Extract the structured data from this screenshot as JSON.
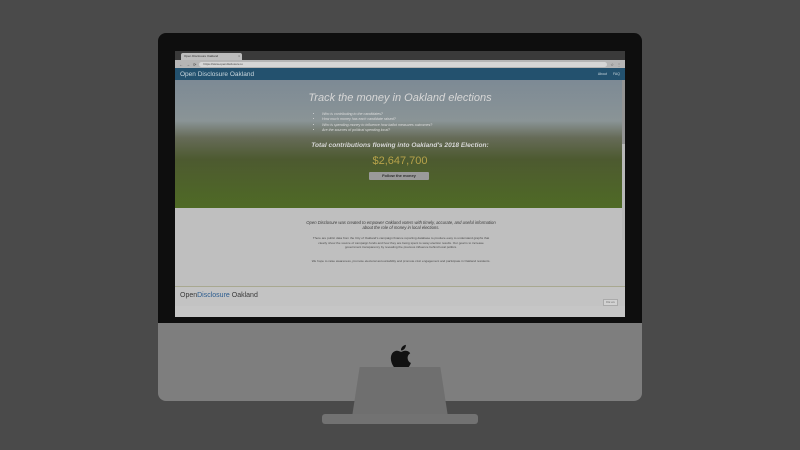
{
  "browser": {
    "tab_title": "Open Disclosure Oakland",
    "tab_close": "×",
    "back": "←",
    "forward": "→",
    "reload": "⟳",
    "url": "https://www.opendisclosure.io",
    "star": "☆",
    "menu": "⋮"
  },
  "site": {
    "brand": "Open Disclosure Oakland",
    "nav": {
      "about": "About",
      "faq": "FAQ"
    }
  },
  "hero": {
    "title": "Track the money in Oakland elections",
    "questions": [
      "Who is contributing to the candidates?",
      "How much money has each candidate raised?",
      "Who is spending money to influence how ballot measures outcomes?",
      "Are the sources of political spending local?"
    ],
    "total_label": "Total contributions flowing into Oakland's 2018 Election:",
    "total_amount": "$2,647,700",
    "cta_label": "Follow the money"
  },
  "content": {
    "intro": "Open Disclosure was created to empower Oakland voters with timely, accurate, and useful information about the role of money in local elections.",
    "paragraph": "There are public data from the City of Oakland's campaign finance reporting database to produce easy to understand graphs that clearly show the source of campaign funds and how they are being spent to sway election results. Our goal is to increase government transparency by revealing the previous influence behind local politics.",
    "mission": "We hope to raise awareness, promote electoral accountability and promote civic engagement and participate in Oakland residents."
  },
  "footer": {
    "logo_open": "Open",
    "logo_disclosure": "Disclosure",
    "logo_city": "Oakland",
    "badge": "Fix on"
  },
  "colors": {
    "navbar": "#23516e",
    "amount": "#b6a24a",
    "logo_accent": "#2b5c8f"
  }
}
